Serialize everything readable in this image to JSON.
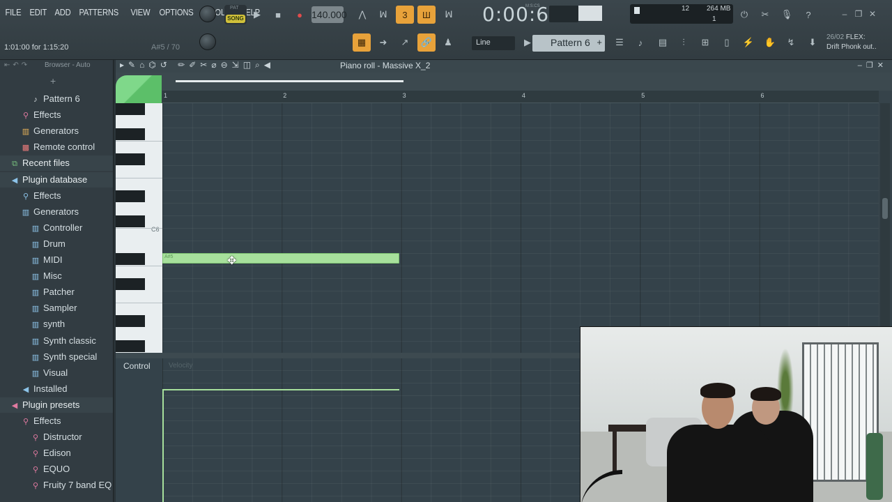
{
  "menu": [
    "FILE",
    "EDIT",
    "ADD",
    "PATTERNS",
    "VIEW",
    "OPTIONS",
    "TOOLS",
    "HELP"
  ],
  "hint_text": "1:01:00 for 1:15:20",
  "hint_note": "A#5 / 70",
  "transport": {
    "pat_label": "PAT",
    "song_label": "SONG",
    "play_icon": "play-icon",
    "stop_icon": "stop-icon",
    "record_icon": "record-icon"
  },
  "tempo": "140.000",
  "time_display": "0:00:66",
  "time_unit": "M:S:CS",
  "cpu": {
    "value1": "12",
    "memory": "264 MB",
    "value2": "1"
  },
  "snap_mode": "Line",
  "pattern_selector": {
    "label": "Pattern 6",
    "plus": "+"
  },
  "news": {
    "date": "26/02",
    "tag": "FLEX:",
    "text": "Drift Phonk out.."
  },
  "browser": {
    "header": "Browser - Auto",
    "plus": "+",
    "items": [
      {
        "label": "Pattern 6",
        "icon": "note-icon",
        "level": 2,
        "color": "white"
      },
      {
        "label": "Effects",
        "icon": "plug-icon",
        "level": 1,
        "color": "pink"
      },
      {
        "label": "Generators",
        "icon": "generator-icon",
        "level": 1,
        "color": "orange"
      },
      {
        "label": "Remote control",
        "icon": "remote-icon",
        "level": 1,
        "color": "red"
      },
      {
        "label": "Recent files",
        "icon": "folder-icon",
        "level": 0,
        "color": "green"
      },
      {
        "label": "Plugin database",
        "icon": "speaker-icon",
        "level": 0,
        "color": "blue"
      },
      {
        "label": "Effects",
        "icon": "plug-icon",
        "level": 1,
        "color": "blue"
      },
      {
        "label": "Generators",
        "icon": "generator-icon",
        "level": 1,
        "color": "blue"
      },
      {
        "label": "Controller",
        "icon": "generator-icon",
        "level": 2,
        "color": "blue"
      },
      {
        "label": "Drum",
        "icon": "generator-icon",
        "level": 2,
        "color": "blue"
      },
      {
        "label": "MIDI",
        "icon": "generator-icon",
        "level": 2,
        "color": "blue"
      },
      {
        "label": "Misc",
        "icon": "generator-icon",
        "level": 2,
        "color": "blue"
      },
      {
        "label": "Patcher",
        "icon": "generator-icon",
        "level": 2,
        "color": "blue"
      },
      {
        "label": "Sampler",
        "icon": "generator-icon",
        "level": 2,
        "color": "blue"
      },
      {
        "label": "synth",
        "icon": "generator-icon",
        "level": 2,
        "color": "blue"
      },
      {
        "label": "Synth classic",
        "icon": "generator-icon",
        "level": 2,
        "color": "blue"
      },
      {
        "label": "Synth special",
        "icon": "generator-icon",
        "level": 2,
        "color": "blue"
      },
      {
        "label": "Visual",
        "icon": "generator-icon",
        "level": 2,
        "color": "blue"
      },
      {
        "label": "Installed",
        "icon": "speaker-icon",
        "level": 1,
        "color": "blue"
      },
      {
        "label": "Plugin presets",
        "icon": "speaker-icon",
        "level": 0,
        "color": "pink"
      },
      {
        "label": "Effects",
        "icon": "plug-icon",
        "level": 1,
        "color": "pink"
      },
      {
        "label": "Distructor",
        "icon": "plug-icon",
        "level": 2,
        "color": "pink"
      },
      {
        "label": "Edison",
        "icon": "plug-icon",
        "level": 2,
        "color": "pink"
      },
      {
        "label": "EQUO",
        "icon": "plug-icon",
        "level": 2,
        "color": "pink"
      },
      {
        "label": "Fruity 7 band EQ",
        "icon": "plug-icon",
        "level": 2,
        "color": "pink"
      }
    ]
  },
  "piano_roll": {
    "title": "Piano roll - Massive X_2",
    "bars": [
      "1",
      "2",
      "3",
      "4",
      "5",
      "6"
    ],
    "key_label": "C6",
    "note": {
      "name": "A#5",
      "velocity": 70
    },
    "control_label": "Control",
    "control_sub": "Velocity"
  },
  "colors": {
    "note": "#a7e09c",
    "accent": "#e8a23a",
    "song": "#d0c03a"
  }
}
